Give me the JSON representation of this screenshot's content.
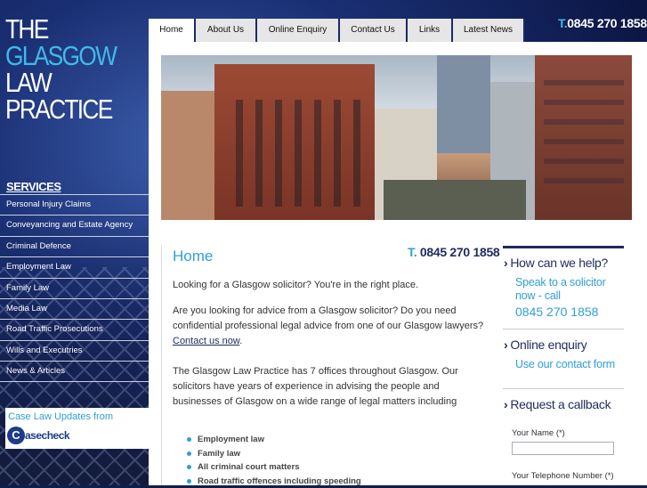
{
  "brand": {
    "logo_lines": [
      "THE",
      "GLASGOW",
      "LAW",
      "PRACTICE"
    ],
    "phone_prefix": "T.",
    "phone_number": "0845 270 1858"
  },
  "nav": {
    "tabs": [
      "Home",
      "About Us",
      "Online Enquiry",
      "Contact Us",
      "Links",
      "Latest News"
    ],
    "active": "Home"
  },
  "sidebar": {
    "services_title": "SERVICES",
    "items": [
      "Personal Injury Claims",
      "Conveyancing and Estate Agency",
      "Criminal Defence",
      "Employment Law",
      "Family Law",
      "Media Law",
      "Road Traffic Prosecutions",
      "Wills and Executries",
      "News & Articles"
    ],
    "case_law_title": "Case Law Updates from",
    "case_logo_text": "asecheck"
  },
  "main": {
    "title": "Home",
    "phone_prefix": "T.",
    "phone_number": "0845 270 1858",
    "intro": "Looking for a Glasgow solicitor? You're in the right place.",
    "para2_text": "Are you looking for advice from a Glasgow solicitor? Do you need confidential professional legal advice from one of our Glasgow lawyers?",
    "para2_link": "Contact us now",
    "para3": "The Glasgow Law Practice has 7 offices throughout Glasgow. Our solicitors have years of experience in advising the people and businesses of Glasgow on a wide range of legal matters including",
    "bullets": [
      "Employment law",
      "Family law",
      "All criminal court matters",
      "Road traffic offences including speeding"
    ]
  },
  "right": {
    "help_head": "How can we help?",
    "help_sub": "Speak to a solicitor now - call",
    "help_phone": "0845 270 1858",
    "enquiry_head": "Online enquiry",
    "enquiry_sub": "Use our contact form",
    "callback_head": "Request a callback",
    "name_label": "Your Name (*)",
    "phone_label": "Your Telephone Number (*)"
  },
  "colors": {
    "accent": "#2f9ed8",
    "navy": "#1f2b5c",
    "background": "#0f1e4d"
  }
}
